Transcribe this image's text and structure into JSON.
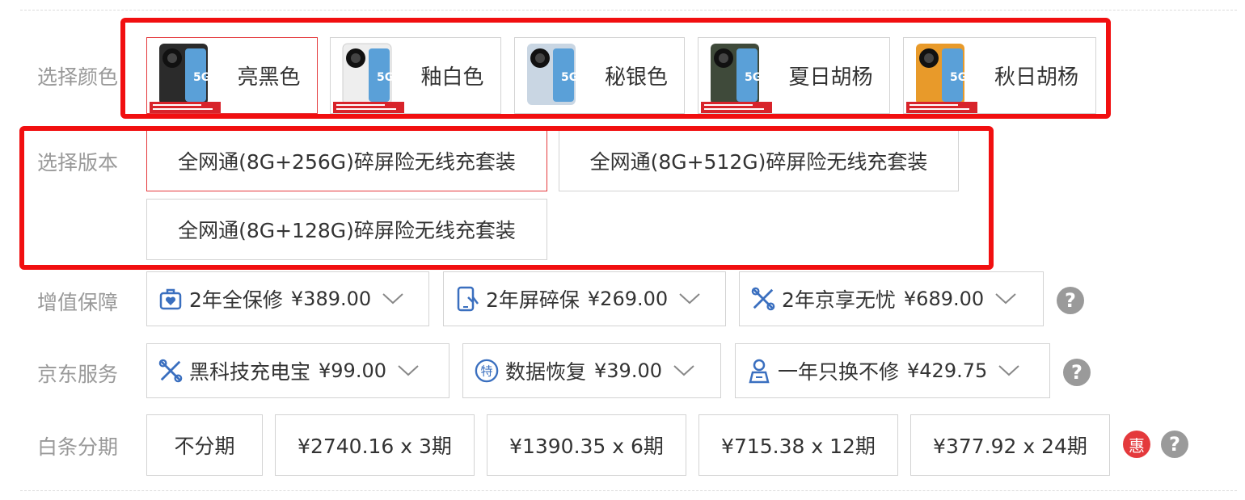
{
  "colors": {
    "label": "选择颜色",
    "options": [
      {
        "name": "亮黑色",
        "phone_color": "#2b2b2b",
        "selected": true
      },
      {
        "name": "釉白色",
        "phone_color": "#eeeeee",
        "selected": false
      },
      {
        "name": "秘银色",
        "phone_color": "#c9d6e3",
        "selected": false
      },
      {
        "name": "夏日胡杨",
        "phone_color": "#3f4a3a",
        "selected": false
      },
      {
        "name": "秋日胡杨",
        "phone_color": "#e89a2a",
        "selected": false
      }
    ]
  },
  "versions": {
    "label": "选择版本",
    "options": [
      {
        "name": "全网通(8G+256G)碎屏险无线充套装",
        "selected": true
      },
      {
        "name": "全网通(8G+512G)碎屏险无线充套装",
        "selected": false
      },
      {
        "name": "全网通(8G+128G)碎屏险无线充套装",
        "selected": false
      }
    ]
  },
  "value_added": {
    "label": "增值保障",
    "items": [
      {
        "name": "2年全保修",
        "price": "¥389.00",
        "icon": "briefcase-heart-icon"
      },
      {
        "name": "2年屏碎保",
        "price": "¥269.00",
        "icon": "phone-shield-icon"
      },
      {
        "name": "2年京享无忧",
        "price": "¥689.00",
        "icon": "tools-icon"
      }
    ]
  },
  "jd_service": {
    "label": "京东服务",
    "items": [
      {
        "name": "黑科技充电宝",
        "price": "¥99.00",
        "icon": "tools-icon"
      },
      {
        "name": "数据恢复",
        "price": "¥39.00",
        "icon": "special-badge-icon"
      },
      {
        "name": "一年只换不修",
        "price": "¥429.75",
        "icon": "person-badge-icon"
      }
    ]
  },
  "installment": {
    "label": "白条分期",
    "options": [
      "不分期",
      "¥2740.16 x 3期",
      "¥1390.35 x 6期",
      "¥715.38 x 12期",
      "¥377.92 x 24期"
    ],
    "promo_badge": "惠"
  },
  "help_icon": "?"
}
